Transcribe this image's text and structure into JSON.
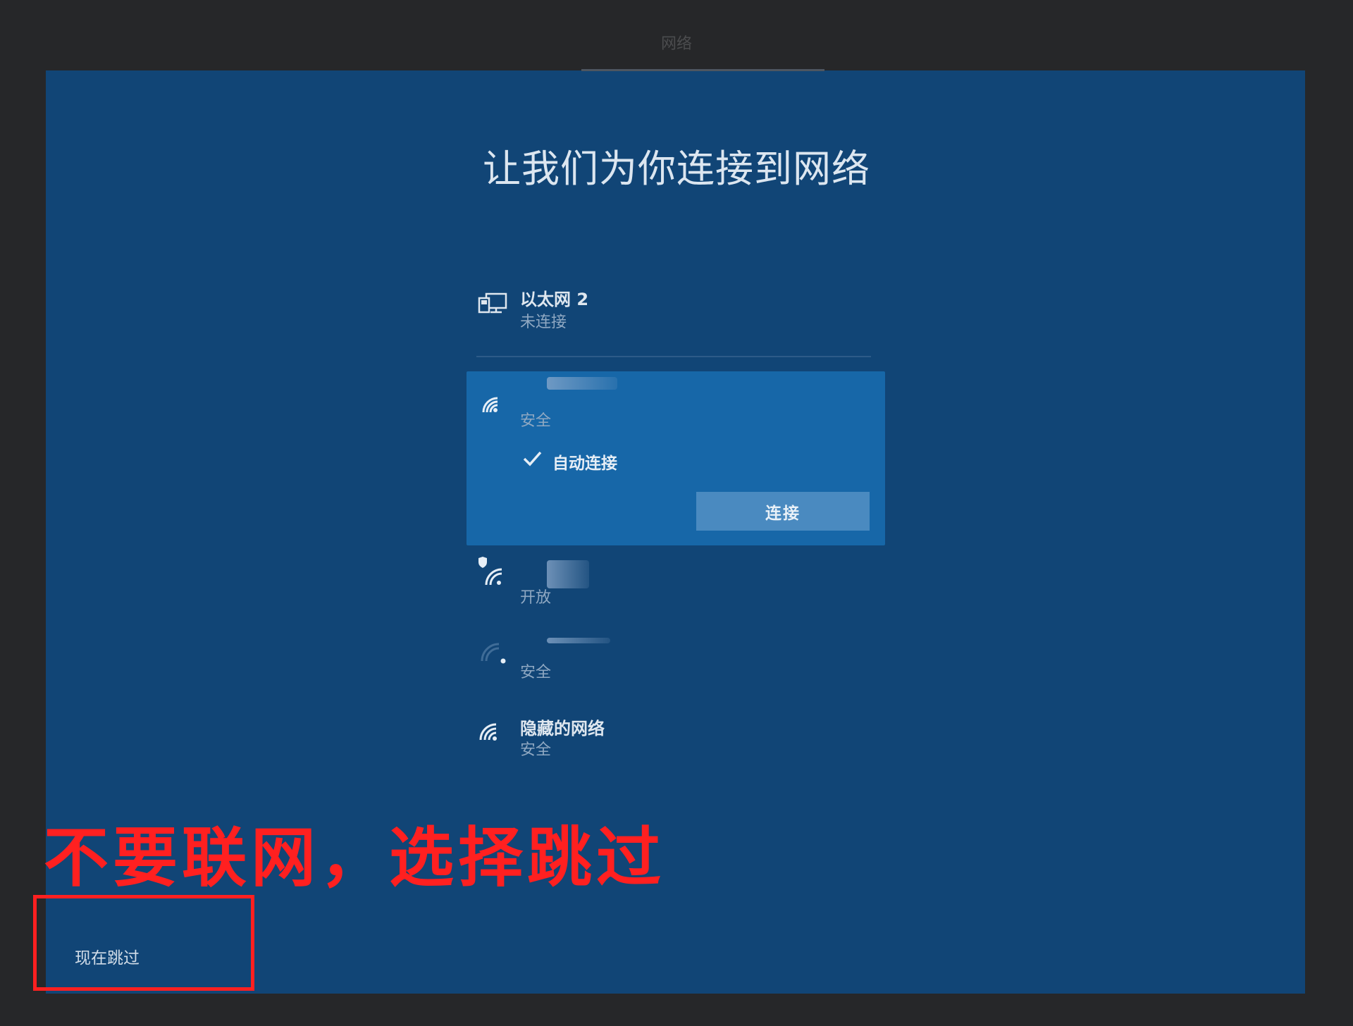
{
  "window": {
    "title": "网络"
  },
  "page": {
    "title": "让我们为你连接到网络"
  },
  "networks": [
    {
      "name": "以太网 2",
      "status": "未连接",
      "icon": "ethernet-icon"
    },
    {
      "name": "",
      "status": "安全",
      "icon": "wifi-icon",
      "selected": true
    },
    {
      "name": "",
      "status": "开放",
      "icon": "wifi-shield-icon"
    },
    {
      "name": "",
      "status": "安全",
      "icon": "wifi-weak-icon"
    },
    {
      "name": "隐藏的网络",
      "status": "安全",
      "icon": "wifi-icon"
    }
  ],
  "selected_panel": {
    "auto_connect_label": "自动连接",
    "auto_connect_checked": true,
    "connect_label": "连接"
  },
  "annotation": {
    "text": "不要联网，选择跳过",
    "color": "#ff2020"
  },
  "skip": {
    "label": "现在跳过"
  },
  "colors": {
    "background": "#114576",
    "accent": "#1767a8",
    "frame": "#262729"
  }
}
